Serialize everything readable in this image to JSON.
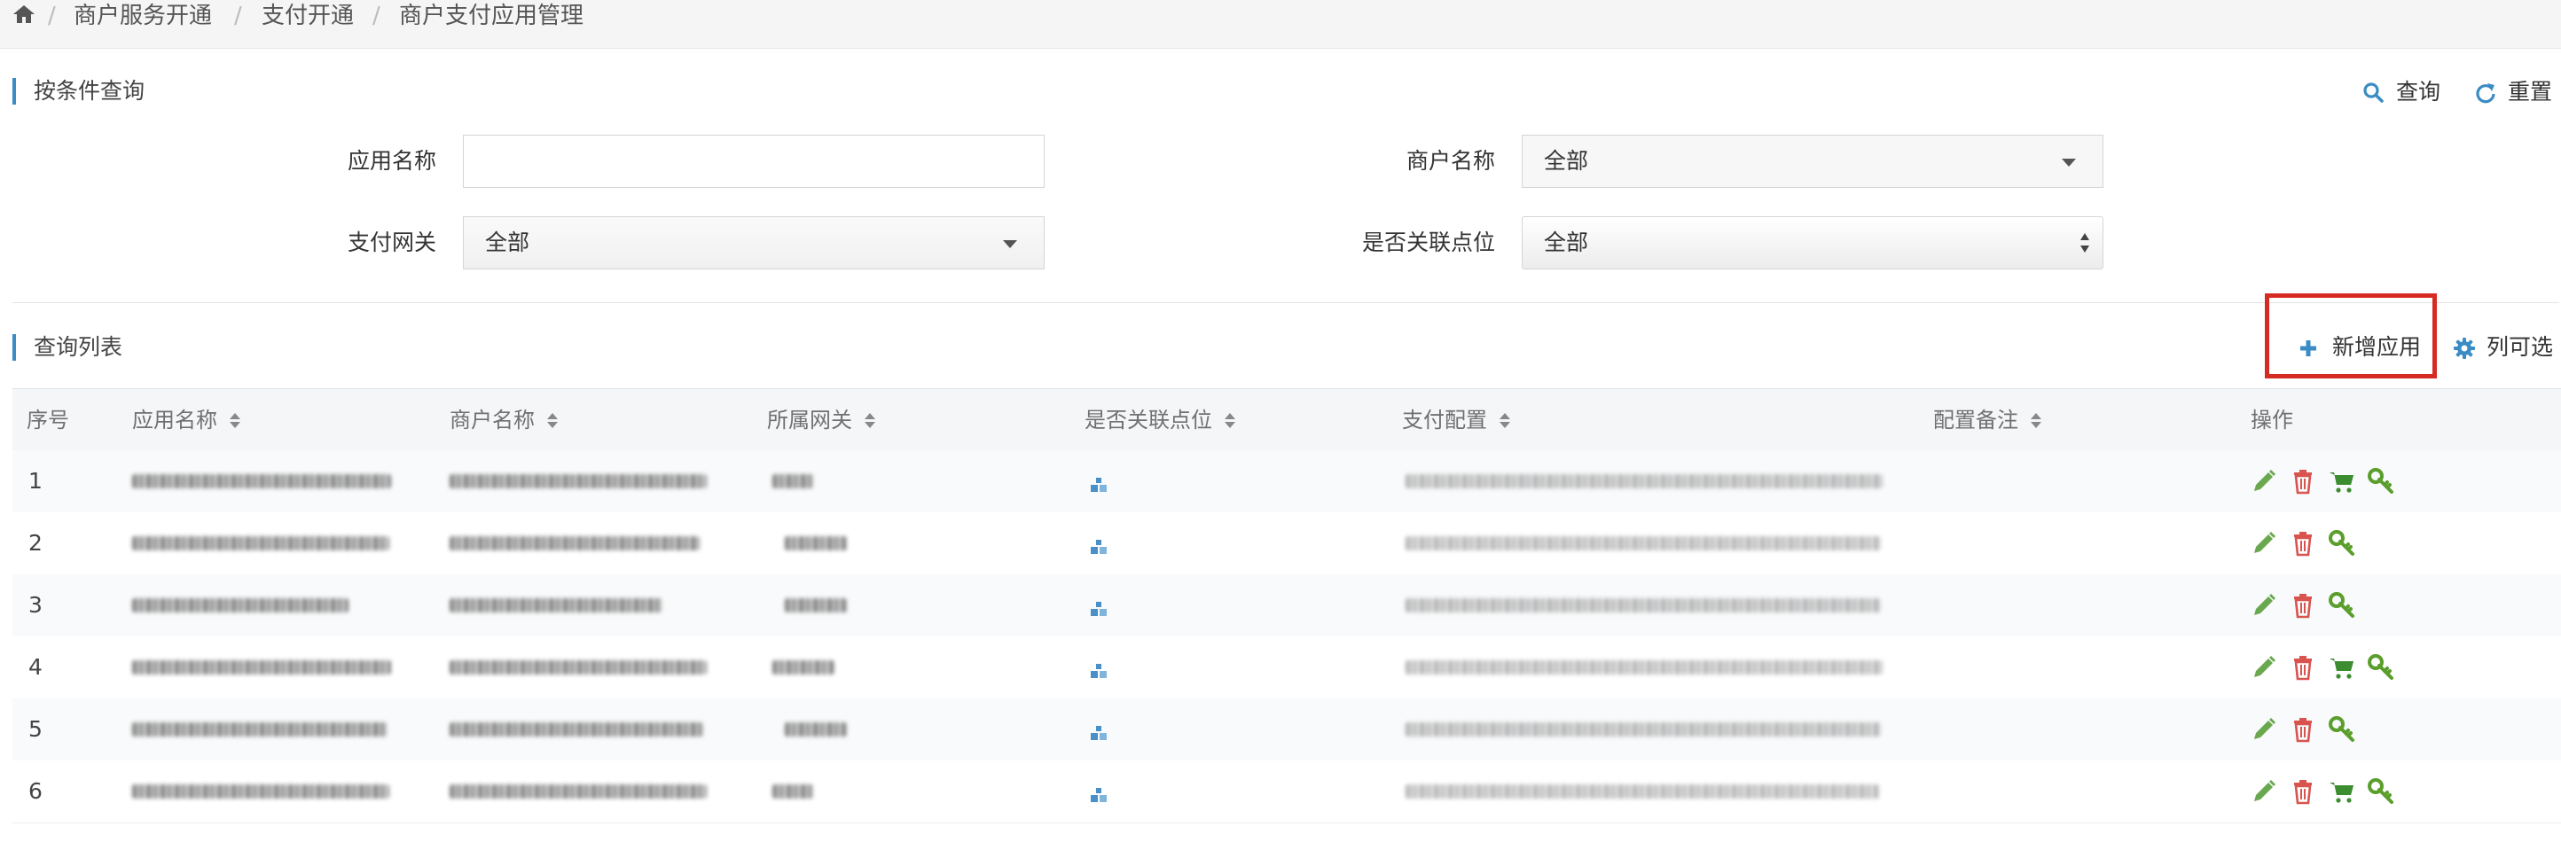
{
  "breadcrumb": {
    "home_icon": "home-icon",
    "items": [
      "商户服务开通",
      "支付开通",
      "商户支付应用管理"
    ],
    "separator": "/"
  },
  "search_panel": {
    "title": "按条件查询",
    "query_label": "查询",
    "reset_label": "重置",
    "fields": {
      "app_name": {
        "label": "应用名称",
        "value": ""
      },
      "merchant_name": {
        "label": "商户名称",
        "value": "全部"
      },
      "pay_gateway": {
        "label": "支付网关",
        "value": "全部"
      },
      "linked_point": {
        "label": "是否关联点位",
        "value": "全部"
      }
    }
  },
  "list_panel": {
    "title": "查询列表",
    "add_label": "新增应用",
    "columns_label": "列可选"
  },
  "table": {
    "headers": [
      "序号",
      "应用名称",
      "商户名称",
      "所属网关",
      "是否关联点位",
      "支付配置",
      "配置备注",
      "操作"
    ],
    "rows": [
      {
        "index": "1",
        "actions": [
          "edit-icon",
          "delete-icon",
          "cart-icon",
          "key-icon"
        ]
      },
      {
        "index": "2",
        "actions": [
          "edit-icon",
          "delete-icon",
          "key-icon"
        ]
      },
      {
        "index": "3",
        "actions": [
          "edit-icon",
          "delete-icon",
          "key-icon"
        ]
      },
      {
        "index": "4",
        "actions": [
          "edit-icon",
          "delete-icon",
          "cart-icon",
          "key-icon"
        ]
      },
      {
        "index": "5",
        "actions": [
          "edit-icon",
          "delete-icon",
          "key-icon"
        ]
      },
      {
        "index": "6",
        "actions": [
          "edit-icon",
          "delete-icon",
          "cart-icon",
          "key-icon"
        ]
      }
    ]
  },
  "colors": {
    "accent_blue": "#3b8cc4",
    "highlight_red": "#d62b23",
    "edit_green": "#6aa84f",
    "delete_red": "#d9534f",
    "cart_green": "#3c8d2f",
    "key_green": "#5a9e2c",
    "link_icon_blue": "#4a90c8"
  }
}
